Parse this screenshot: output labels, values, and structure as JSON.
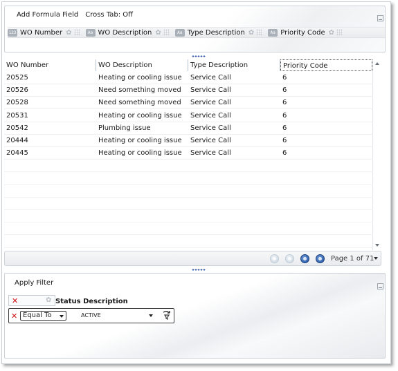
{
  "toolbar": {
    "add_formula": "Add Formula Field",
    "cross_tab": "Cross Tab: Off"
  },
  "field_chips": [
    {
      "type_icon": "123",
      "label": "WO Number"
    },
    {
      "type_icon": "Aa",
      "label": "WO Description"
    },
    {
      "type_icon": "Aa",
      "label": "Type Description"
    },
    {
      "type_icon": "Aa",
      "label": "Priority Code"
    }
  ],
  "grid": {
    "columns": [
      "WO Number",
      "WO Description",
      "Type Description",
      "Priority Code"
    ],
    "rows": [
      [
        "20525",
        "Heating or cooling issue",
        "Service Call",
        "6"
      ],
      [
        "20526",
        "Need something moved",
        "Service Call",
        "6"
      ],
      [
        "20528",
        "Need something moved",
        "Service Call",
        "6"
      ],
      [
        "20531",
        "Heating or cooling issue",
        "Service Call",
        "6"
      ],
      [
        "20542",
        "Plumbing issue",
        "Service Call",
        "6"
      ],
      [
        "20444",
        "Heating or cooling issue",
        "Service Call",
        "6"
      ],
      [
        "20445",
        "Heating or cooling issue",
        "Service Call",
        "6"
      ]
    ]
  },
  "pager": {
    "label": "Page 1 of 71"
  },
  "filter": {
    "title": "Apply Filter",
    "field_label": "Status Description",
    "operator": "Equal To",
    "value": "ACTIVE"
  },
  "colors": {
    "accent": "#1f4f9e",
    "remove": "#cc1111",
    "border": "#cdd3d9"
  }
}
